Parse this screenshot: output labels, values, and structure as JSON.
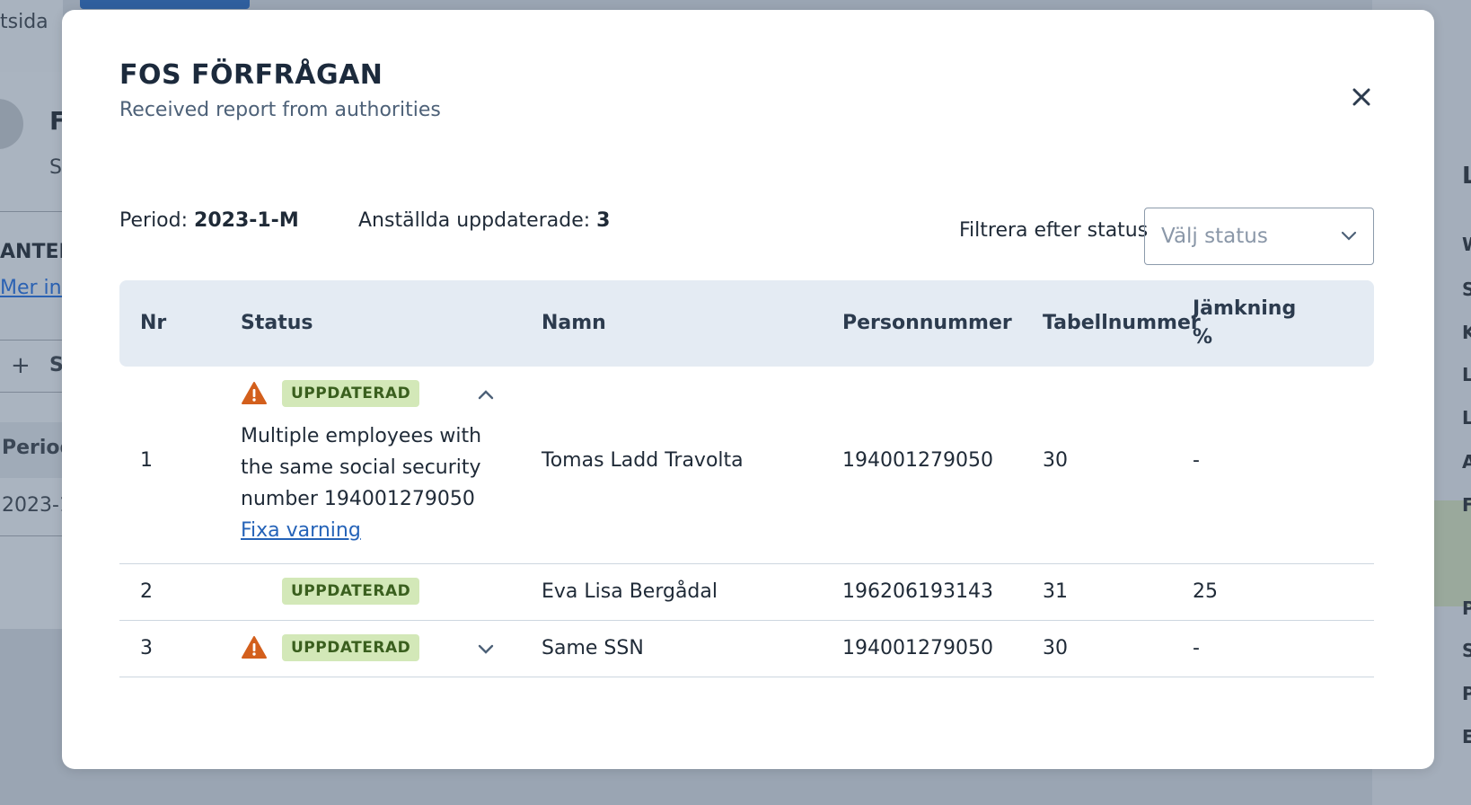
{
  "background": {
    "left_texts": [
      "tsida",
      "F",
      "S",
      "ANTEF",
      "Mer infor",
      "+",
      "S",
      "Period",
      "2023-1"
    ],
    "right_letters": [
      "L",
      "W",
      "S",
      "K",
      "L",
      "L",
      "A",
      "F",
      "P",
      "S",
      "P",
      "E"
    ]
  },
  "modal": {
    "title": "FOS FÖRFRÅGAN",
    "subtitle": "Received report from authorities",
    "close_icon": "close-icon"
  },
  "meta": {
    "period_label": "Period: ",
    "period_value": "2023-1-M",
    "updated_label": "Anställda uppdaterade: ",
    "updated_value": "3"
  },
  "filter": {
    "label": "Filtrera efter status",
    "placeholder": "Välj status",
    "icon": "chevron-down-icon"
  },
  "table": {
    "headers": {
      "nr": "Nr",
      "status": "Status",
      "namn": "Namn",
      "personnummer": "Personnummer",
      "tabellnummer": "Tabellnummer",
      "jamkning": "Jämkning %"
    },
    "rows": [
      {
        "nr": "1",
        "status": "UPPDATERAD",
        "warning": true,
        "expanded": true,
        "warning_text": "Multiple employees with the same social security number 194001279050",
        "fix_link": "Fixa varning",
        "namn": "Tomas Ladd Travolta",
        "personnummer": "194001279050",
        "tabellnummer": "30",
        "jamkning": "-"
      },
      {
        "nr": "2",
        "status": "UPPDATERAD",
        "warning": false,
        "namn": "Eva Lisa Bergådal",
        "personnummer": "196206193143",
        "tabellnummer": "31",
        "jamkning": "25"
      },
      {
        "nr": "3",
        "status": "UPPDATERAD",
        "warning": true,
        "expanded": false,
        "namn": "Same SSN",
        "personnummer": "194001279050",
        "tabellnummer": "30",
        "jamkning": "-"
      }
    ]
  },
  "colors": {
    "badge_bg": "#d3e8b8",
    "badge_text": "#3a5f1e",
    "warning": "#d35f1c",
    "link": "#2563b8",
    "header_bg": "#e4ebf3"
  }
}
